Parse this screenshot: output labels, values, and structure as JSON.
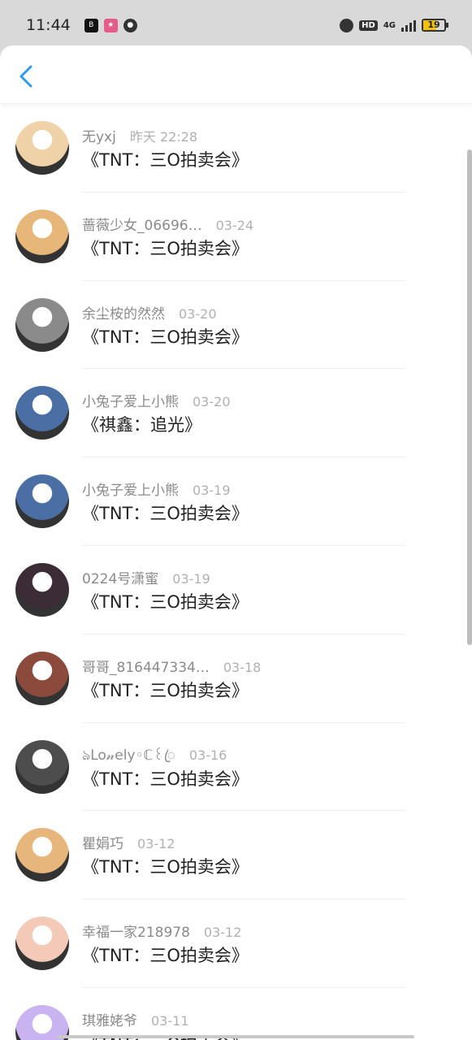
{
  "status_bar": {
    "time": "11:44",
    "network": "4G",
    "battery": "19",
    "hd": "HD"
  },
  "colors": {
    "accent": "#2e9bea",
    "title_text": "#222222",
    "meta_text": "#999999"
  },
  "nav": {
    "back_icon": "chevron-left-icon"
  },
  "comments": [
    {
      "user": "无yxj",
      "date": "昨天 22:28",
      "title": "《TNT：三O拍卖会》",
      "avatar_color": "#f0d2a8"
    },
    {
      "user": "蔷薇少女_06696…",
      "date": "03-24",
      "title": "《TNT：三O拍卖会》",
      "avatar_color": "#e7b77a"
    },
    {
      "user": "余尘桉的然然",
      "date": "03-20",
      "title": "《TNT：三O拍卖会》",
      "avatar_color": "#8a8a8a"
    },
    {
      "user": "小兔子爱上小熊",
      "date": "03-20",
      "title": "《祺鑫：追光》",
      "avatar_color": "#4a6fa5"
    },
    {
      "user": "小兔子爱上小熊",
      "date": "03-19",
      "title": "《TNT：三O拍卖会》",
      "avatar_color": "#4a6fa5"
    },
    {
      "user": "0224号潇蜜",
      "date": "03-19",
      "title": "《TNT：三O拍卖会》",
      "avatar_color": "#3b2c35"
    },
    {
      "user": "哥哥_816447334…",
      "date": "03-18",
      "title": "《TNT：三O拍卖会》",
      "avatar_color": "#8b4a3c"
    },
    {
      "user": "ঌLo𝓃ely◦ℂ꒰ꦿ",
      "date": "03-16",
      "title": "《TNT：三O拍卖会》",
      "avatar_color": "#4d4d4d"
    },
    {
      "user": "瞿娟巧",
      "date": "03-12",
      "title": "《TNT：三O拍卖会》",
      "avatar_color": "#e6b67c"
    },
    {
      "user": "幸福一家218978",
      "date": "03-12",
      "title": "《TNT：三O拍卖会》",
      "avatar_color": "#f3c9b8"
    },
    {
      "user": "琪雅姥爷",
      "date": "03-11",
      "title": "《TNT：三O拍卖会》",
      "avatar_color": "#c9b3f0"
    }
  ]
}
